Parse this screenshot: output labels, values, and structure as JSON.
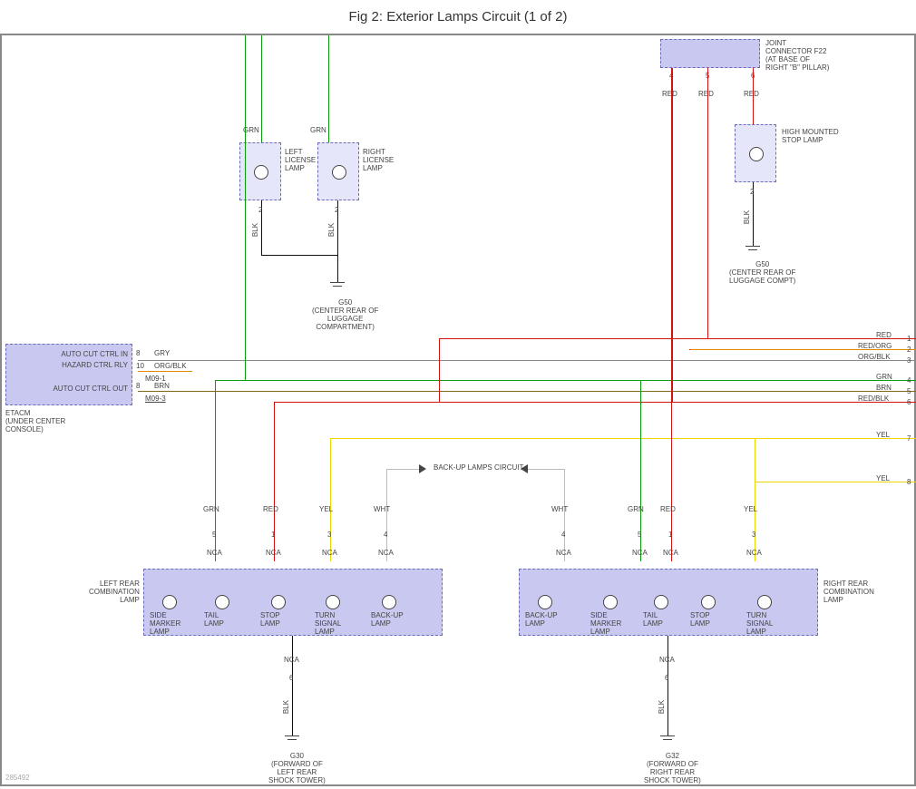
{
  "title": "Fig 2: Exterior Lamps Circuit (1 of 2)",
  "components": {
    "etacm": {
      "pins": [
        "AUTO CUT CTRL IN",
        "HAZARD CTRL RLY",
        "",
        "AUTO CUT CTRL OUT"
      ],
      "name": "ETACM\n(UNDER CENTER\nCONSOLE)",
      "pin_nums": [
        "8",
        "10",
        "",
        "8"
      ],
      "conn": [
        "M09-1",
        "M09-3"
      ]
    },
    "left_license": "LEFT\nLICENSE\nLAMP",
    "right_license": "RIGHT\nLICENSE\nLAMP",
    "high_stop": "HIGH MOUNTED\nSTOP LAMP",
    "joint_f22": "JOINT\nCONNECTOR F22\n(AT BASE OF\nRIGHT \"B\" PILLAR)",
    "g50": "G50\n(CENTER REAR OF\nLUGGAGE\nCOMPARTMENT)",
    "g50b": "G50\n(CENTER REAR OF\nLUGGAGE COMPT)",
    "g30": "G30\n(FORWARD OF\nLEFT REAR\nSHOCK TOWER)",
    "g32": "G32\n(FORWARD OF\nRIGHT REAR\nSHOCK TOWER)",
    "left_combo": {
      "name": "LEFT REAR\nCOMBINATION\nLAMP",
      "lamps": [
        "SIDE\nMARKER\nLAMP",
        "TAIL\nLAMP",
        "STOP\nLAMP",
        "TURN\nSIGNAL\nLAMP",
        "BACK-UP\nLAMP"
      ]
    },
    "right_combo": {
      "name": "RIGHT REAR\nCOMBINATION\nLAMP",
      "lamps": [
        "BACK-UP\nLAMP",
        "SIDE\nMARKER\nLAMP",
        "TAIL\nLAMP",
        "STOP\nLAMP",
        "TURN\nSIGNAL\nLAMP"
      ]
    },
    "backup_circuit": "BACK-UP LAMPS CIRCUIT"
  },
  "wire_labels": {
    "grn": "GRN",
    "red": "RED",
    "yel": "YEL",
    "brn": "BRN",
    "gry": "GRY",
    "blk": "BLK",
    "wht": "WHT",
    "orgblk": "ORG/BLK",
    "redorg": "RED/ORG",
    "redblk": "RED/BLK",
    "nca": "NCA"
  },
  "right_bus": [
    {
      "num": "1",
      "lbl": "RED"
    },
    {
      "num": "2",
      "lbl": "RED/ORG"
    },
    {
      "num": "3",
      "lbl": "ORG/BLK"
    },
    {
      "num": "4",
      "lbl": "GRN"
    },
    {
      "num": "5",
      "lbl": "BRN"
    },
    {
      "num": "6",
      "lbl": "RED/BLK"
    },
    {
      "num": "7",
      "lbl": "YEL"
    },
    {
      "num": "8",
      "lbl": "YEL"
    }
  ],
  "top_pins": {
    "left_grn": [
      "GRN",
      "GRN"
    ],
    "f22": [
      "4",
      "5",
      "6"
    ],
    "f22_red": [
      "RED",
      "RED",
      "RED"
    ]
  },
  "misc": {
    "source_id": "285492"
  }
}
